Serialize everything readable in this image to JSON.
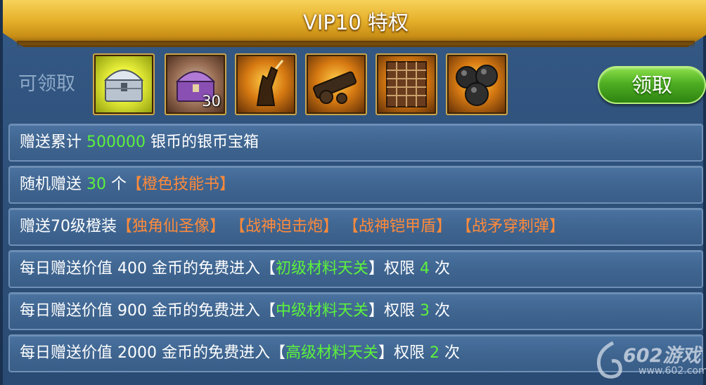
{
  "title": "VIP10 特权",
  "claimable_label": "可领取",
  "claim_button": "领取",
  "rewards": [
    {
      "icon": "silver-treasure-chest-icon"
    },
    {
      "icon": "purple-treasure-chest-icon",
      "quantity": "30"
    },
    {
      "icon": "unicorn-statue-icon"
    },
    {
      "icon": "mortar-cannon-icon"
    },
    {
      "icon": "armor-shield-icon"
    },
    {
      "icon": "cannonballs-icon"
    }
  ],
  "privileges": [
    [
      {
        "text": "赠送累计 ",
        "color": "white"
      },
      {
        "text": "500000",
        "color": "green"
      },
      {
        "text": " 银币的银币宝箱",
        "color": "white"
      }
    ],
    [
      {
        "text": "随机赠送 ",
        "color": "white"
      },
      {
        "text": "30",
        "color": "green"
      },
      {
        "text": " 个",
        "color": "white"
      },
      {
        "text": "【橙色技能书】",
        "color": "orange"
      }
    ],
    [
      {
        "text": "赠送70级橙装",
        "color": "white"
      },
      {
        "text": "【独角仙圣像】",
        "color": "orange"
      },
      {
        "text": " ",
        "color": "white"
      },
      {
        "text": "【战神迫击炮】",
        "color": "orange"
      },
      {
        "text": " ",
        "color": "white"
      },
      {
        "text": "【战神铠甲盾】",
        "color": "orange"
      },
      {
        "text": " ",
        "color": "white"
      },
      {
        "text": "【战矛穿刺弹】",
        "color": "orange"
      }
    ],
    [
      {
        "text": "每日赠送价值 400 金币的免费进入【",
        "color": "white"
      },
      {
        "text": "初级材料天关",
        "color": "green"
      },
      {
        "text": "】权限 ",
        "color": "white"
      },
      {
        "text": "4",
        "color": "green"
      },
      {
        "text": " 次",
        "color": "white"
      }
    ],
    [
      {
        "text": "每日赠送价值 900 金币的免费进入【",
        "color": "white"
      },
      {
        "text": "中级材料天关",
        "color": "green"
      },
      {
        "text": "】权限 ",
        "color": "white"
      },
      {
        "text": "3",
        "color": "green"
      },
      {
        "text": " 次",
        "color": "white"
      }
    ],
    [
      {
        "text": "每日赠送价值 2000 金币的免费进入【",
        "color": "white"
      },
      {
        "text": "高级材料天关",
        "color": "green"
      },
      {
        "text": "】权限 ",
        "color": "white"
      },
      {
        "text": "2",
        "color": "green"
      },
      {
        "text": " 次",
        "color": "white"
      }
    ]
  ],
  "watermark": {
    "name": "602游戏",
    "url": "www.602.com"
  },
  "colors": {
    "green": "#5cf23c",
    "orange": "#ff8a3a",
    "white": "#ffffff",
    "banner": "#e6b12b",
    "claim": "#4eae22"
  }
}
